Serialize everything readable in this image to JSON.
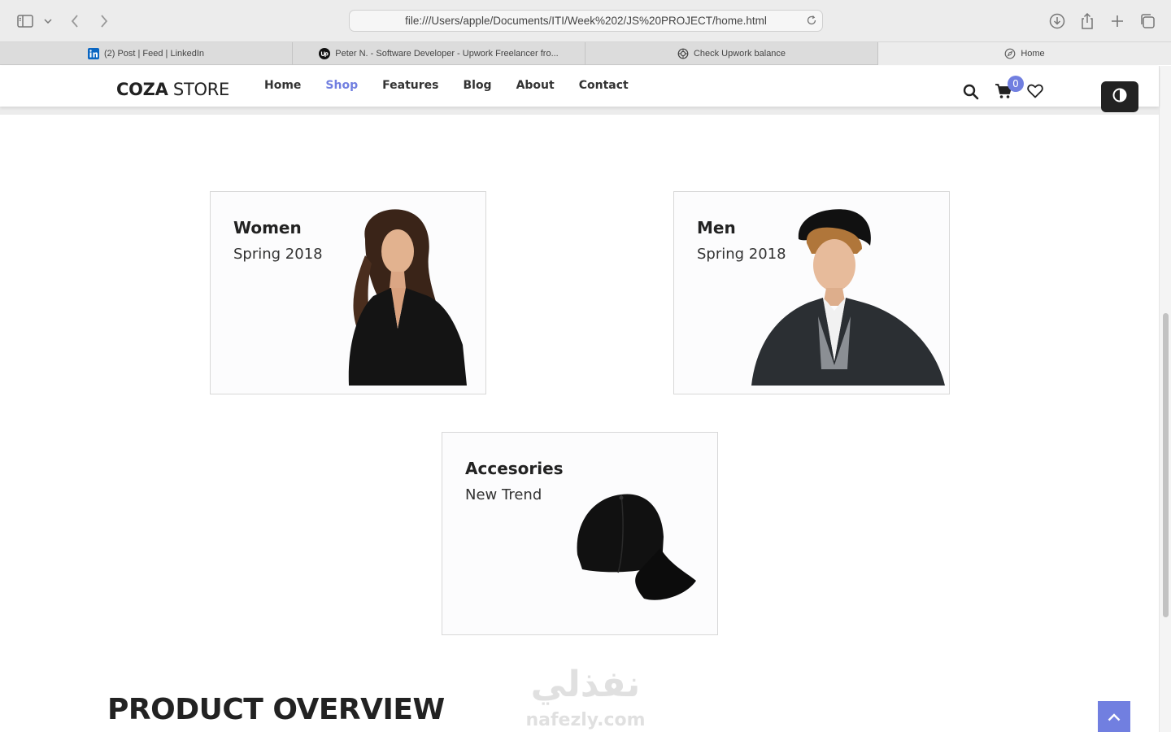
{
  "browser": {
    "url": "file:///Users/apple/Documents/ITI/Week%202/JS%20PROJECT/home.html",
    "icons": [
      "sidebar-icon",
      "chevron-down-icon",
      "back-icon",
      "forward-icon",
      "reload-icon",
      "download-icon",
      "share-icon",
      "new-tab-icon",
      "tab-overview-icon"
    ],
    "tabs": [
      {
        "label": "(2) Post | Feed | LinkedIn",
        "icon": "linkedin-icon"
      },
      {
        "label": "Peter N. - Software Developer - Upwork Freelancer fro...",
        "icon": "upwork-icon"
      },
      {
        "label": "Check Upwork balance",
        "icon": "openai-icon"
      },
      {
        "label": "Home",
        "icon": "compass-icon"
      }
    ]
  },
  "header": {
    "logo_bold": "COZA",
    "logo_light": " STORE",
    "nav": [
      "Home",
      "Shop",
      "Features",
      "Blog",
      "About",
      "Contact"
    ],
    "active_nav": "Shop",
    "cart_count": "0",
    "icons": [
      "search-icon",
      "cart-icon",
      "heart-icon",
      "theme-toggle-icon"
    ]
  },
  "banners": [
    {
      "title": "Women",
      "subtitle": "Spring 2018",
      "image": "woman-model"
    },
    {
      "title": "Men",
      "subtitle": "Spring 2018",
      "image": "man-model"
    },
    {
      "title": "Accesories",
      "subtitle": "New Trend",
      "image": "black-cap"
    }
  ],
  "section": {
    "title": "PRODUCT OVERVIEW"
  },
  "watermark": {
    "text_ar": "نفذلي",
    "text_en": "nafezly.com"
  },
  "colors": {
    "accent": "#717fe0",
    "text": "#222222",
    "dark_button": "#222222"
  }
}
